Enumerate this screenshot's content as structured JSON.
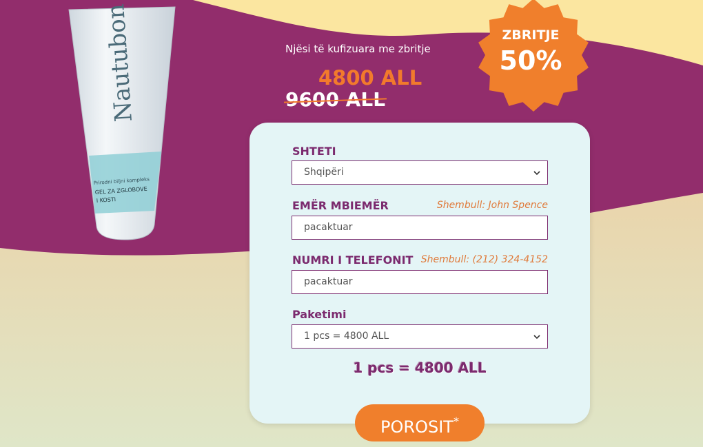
{
  "offer": {
    "limited_text": "Njësi të kufizuara me zbritje",
    "new_price": "4800 ALL",
    "old_price": "9600 ALL"
  },
  "badge": {
    "label": "ZBRITJE",
    "value": "50%"
  },
  "product": {
    "brand_text": "Nautubone",
    "sub_text": "GEL ZA ZGLOBOVE I KOSTI",
    "small_text": "Prirodni biljni kompleks"
  },
  "form": {
    "country": {
      "label": "SHTETI",
      "value": "Shqipëri"
    },
    "name": {
      "label": "EMËR MBIEMËR",
      "hint": "Shembull: John Spence",
      "placeholder": "pacaktuar"
    },
    "phone": {
      "label": "NUMRI I TELEFONIT",
      "hint": "Shembull: (212) 324-4152",
      "placeholder": "pacaktuar"
    },
    "package": {
      "label": "Paketimi",
      "value": "1 pcs = 4800 ALL"
    },
    "summary": "1 pcs = 4800 ALL",
    "submit_label": "POROSIT",
    "submit_mark": "*"
  },
  "colors": {
    "purple": "#8f2d6f",
    "orange": "#f07f2c",
    "cream": "#f9e3a2",
    "card": "#e4f5f6"
  }
}
